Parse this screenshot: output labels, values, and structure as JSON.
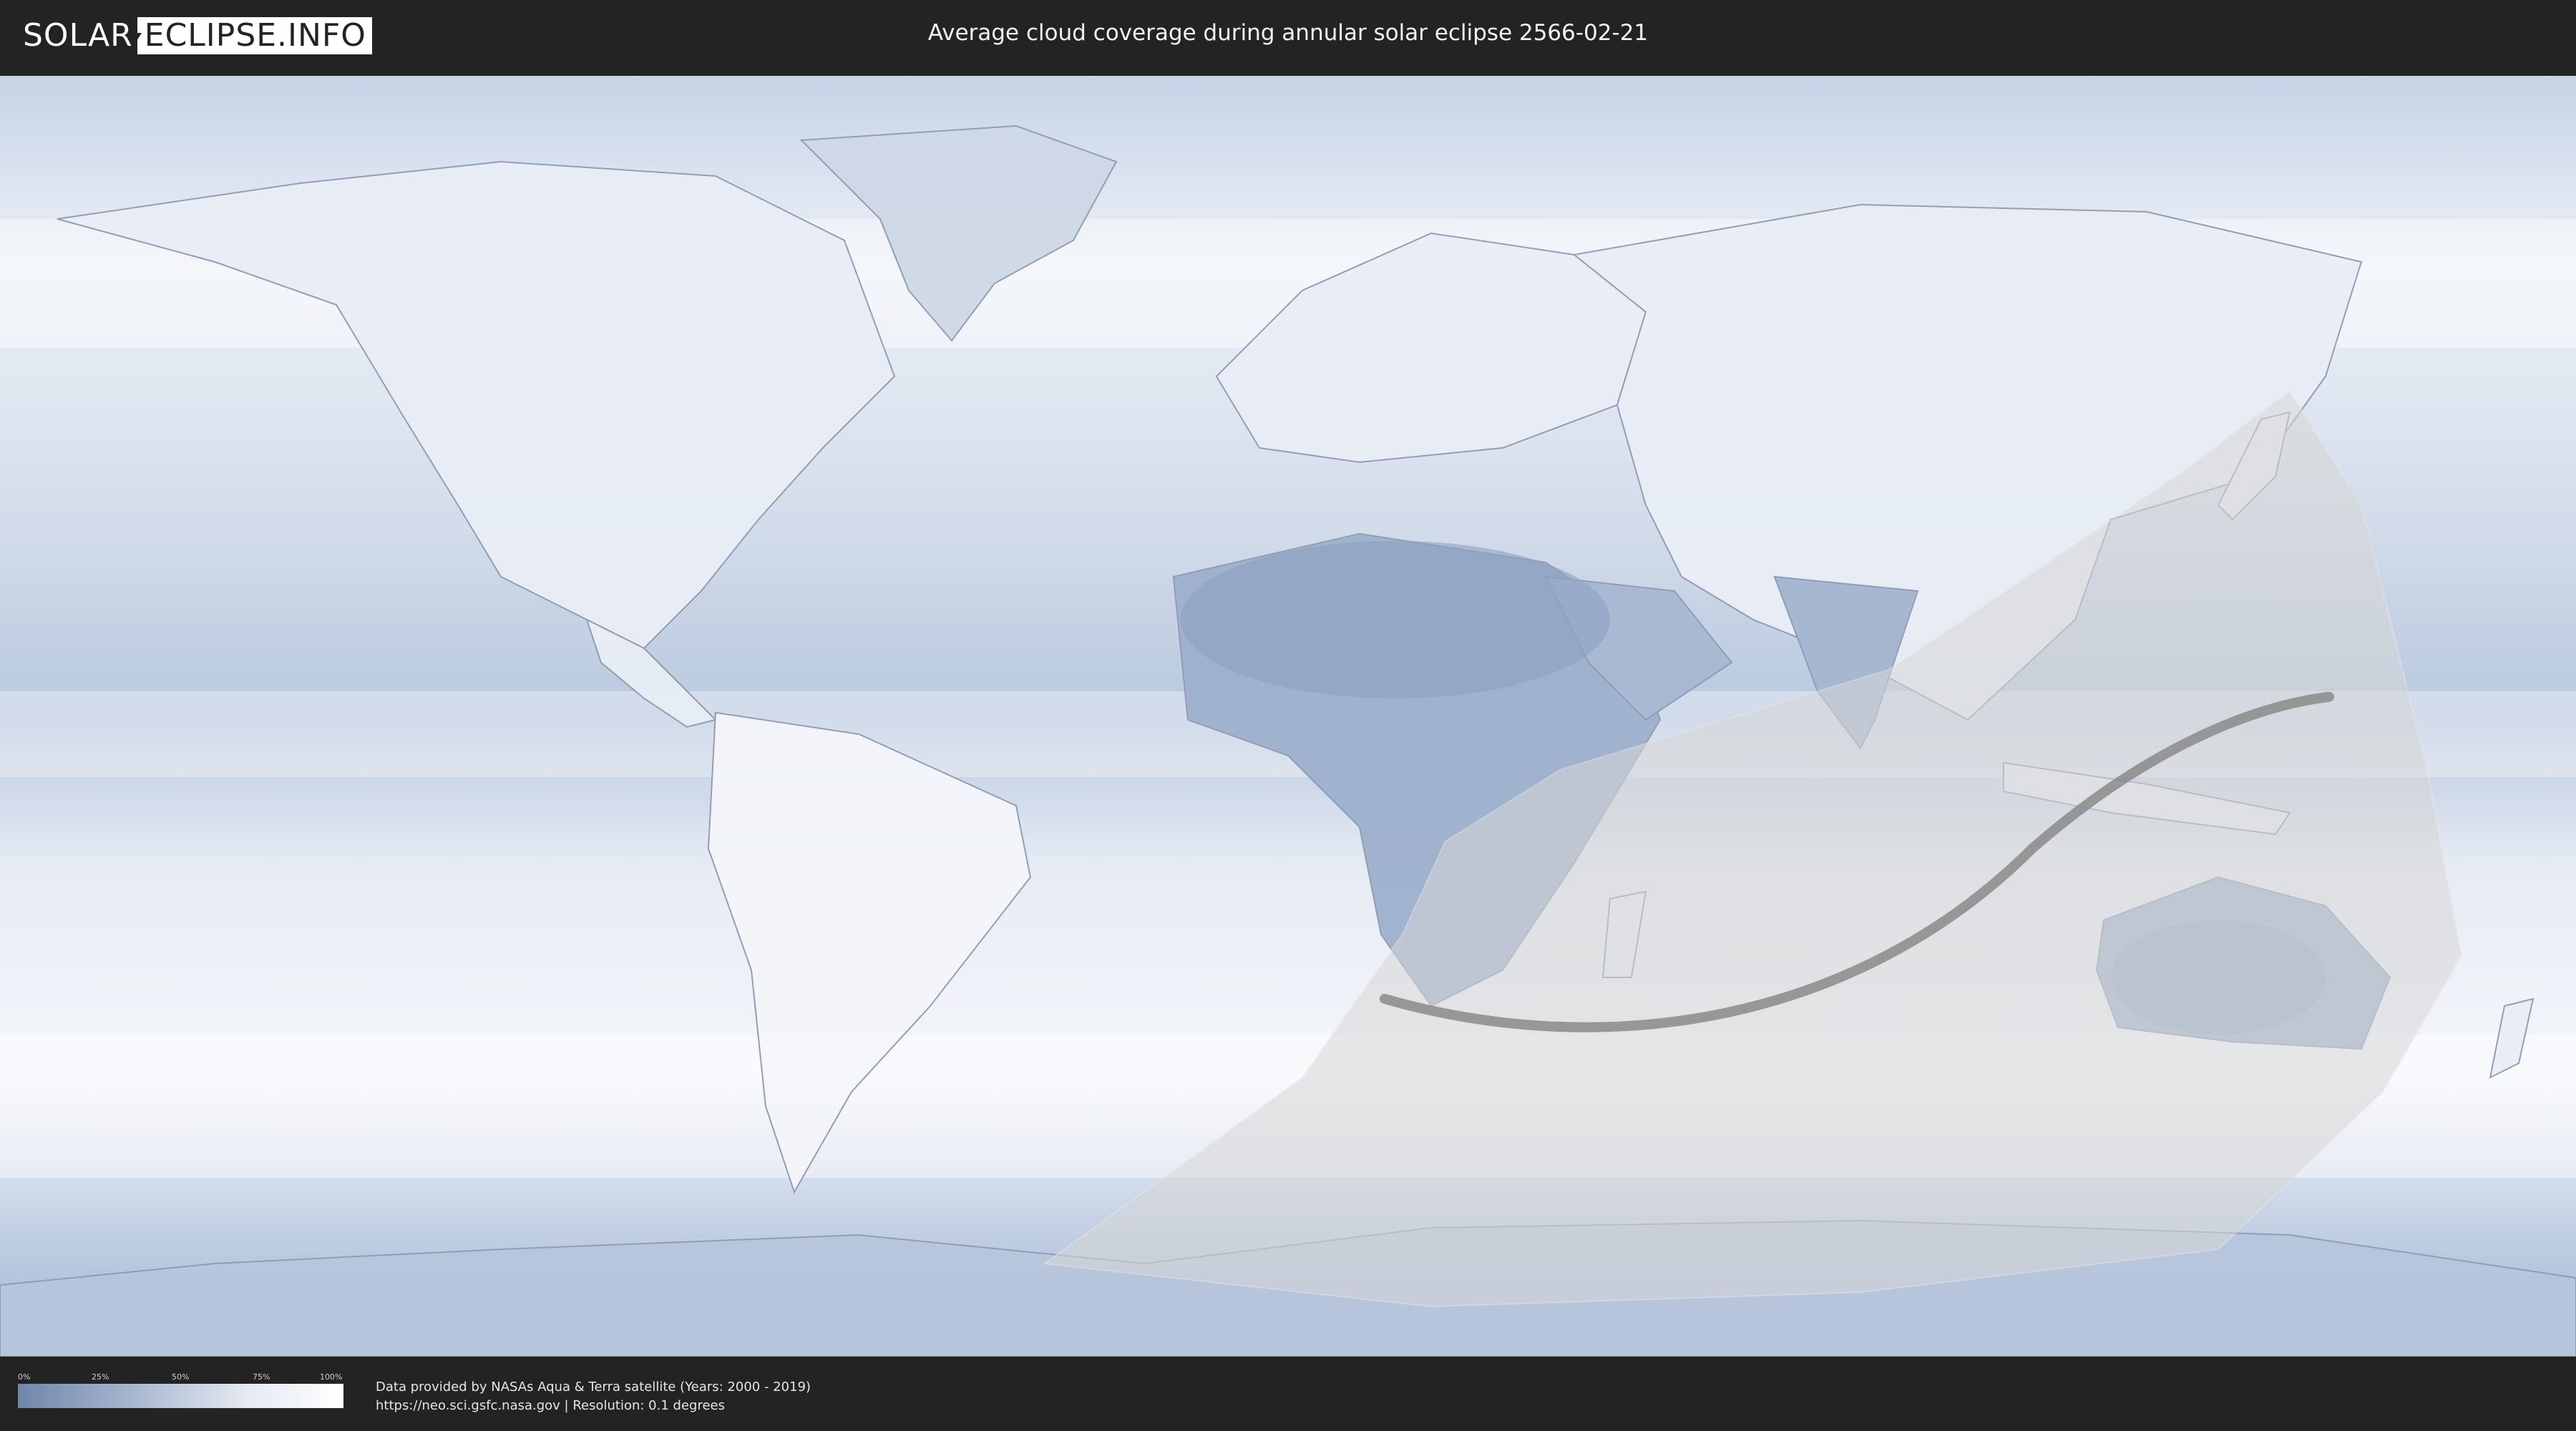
{
  "header": {
    "logo_left": "SOLAR",
    "logo_right": "ECLIPSE.INFO",
    "title": "Average cloud coverage during annular solar eclipse 2566-02-21"
  },
  "legend": {
    "ticks": [
      "0%",
      "25%",
      "50%",
      "75%",
      "100%"
    ],
    "colors": {
      "low": "#6f86ab",
      "high": "#ffffff"
    }
  },
  "credits": {
    "line1": "Data provided by NASAs Aqua & Terra satellite (Years: 2000 - 2019)",
    "line2": "https://neo.sci.gsfc.nasa.gov | Resolution: 0.1 degrees"
  },
  "colors": {
    "background": "#222222",
    "ocean_cloudy": "#dfe6ef",
    "land_clear": "#8ea1c2",
    "eclipse_region": "#d7d7d7",
    "central_path": "#8a8a8a"
  }
}
